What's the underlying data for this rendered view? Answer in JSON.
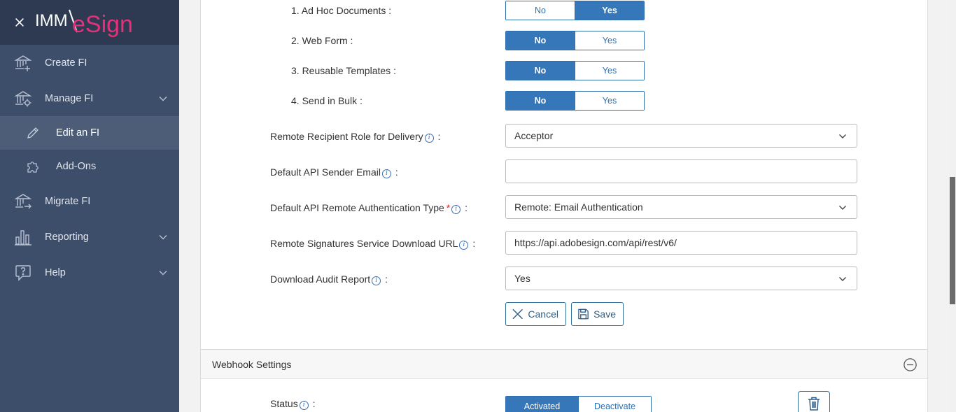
{
  "brand": {
    "name_part1": "IMM",
    "name_part2": "eSign"
  },
  "sidebar": {
    "items": [
      {
        "label": "Create FI",
        "icon": "bank-plus-icon"
      },
      {
        "label": "Manage FI",
        "icon": "bank-gear-icon",
        "expandable": true
      },
      {
        "label": "Edit an FI",
        "icon": "pencil-icon",
        "sub": true,
        "active": true
      },
      {
        "label": "Add-Ons",
        "icon": "puzzle-icon",
        "sub": true
      },
      {
        "label": "Migrate FI",
        "icon": "bank-arrow-icon"
      },
      {
        "label": "Reporting",
        "icon": "bar-chart-icon",
        "expandable": true
      },
      {
        "label": "Help",
        "icon": "help-bubble-icon",
        "expandable": true
      }
    ]
  },
  "form": {
    "features": [
      {
        "label": "1. Ad Hoc Documents :",
        "no": "No",
        "yes": "Yes",
        "selected": "Yes"
      },
      {
        "label": "2. Web Form :",
        "no": "No",
        "yes": "Yes",
        "selected": "No"
      },
      {
        "label": "3. Reusable Templates :",
        "no": "No",
        "yes": "Yes",
        "selected": "No"
      },
      {
        "label": "4. Send in Bulk :",
        "no": "No",
        "yes": "Yes",
        "selected": "No"
      }
    ],
    "remote_role": {
      "label": "Remote Recipient Role for Delivery",
      "value": "Acceptor"
    },
    "sender_email": {
      "label": "Default API Sender Email",
      "value": ""
    },
    "auth_type": {
      "label": "Default API Remote Authentication Type",
      "required": "*",
      "value": "Remote: Email Authentication"
    },
    "download_url": {
      "label": "Remote Signatures Service Download URL",
      "value": "https://api.adobesign.com/api/rest/v6/"
    },
    "audit_report": {
      "label": "Download Audit Report",
      "value": "Yes"
    },
    "colon": ":",
    "info_glyph": "i",
    "cancel_label": "Cancel",
    "save_label": "Save"
  },
  "webhook": {
    "title": "Webhook Settings",
    "status_label": "Status",
    "activated": "Activated",
    "deactivate": "Deactivate"
  },
  "colors": {
    "sidebar_bg": "#3d4e6a",
    "sidebar_header": "#2d3a52",
    "accent": "#3577b8",
    "logo_accent": "#e4317a"
  }
}
